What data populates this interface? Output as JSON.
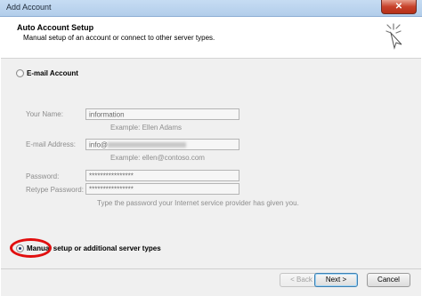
{
  "window": {
    "title": "Add Account",
    "close_glyph": "✕"
  },
  "header": {
    "title": "Auto Account Setup",
    "subtitle": "Manual setup of an account or connect to other server types.",
    "icon": "wizard-sparkle-icon"
  },
  "options": {
    "email_account": {
      "label": "E-mail Account",
      "selected": false
    },
    "manual_setup": {
      "label": "Manual setup or additional server types",
      "selected": true
    }
  },
  "form": {
    "your_name": {
      "label": "Your Name:",
      "value": "information",
      "example": "Example: Ellen Adams"
    },
    "email_address": {
      "label": "E-mail Address:",
      "value_prefix": "info@",
      "example": "Example: ellen@contoso.com"
    },
    "password": {
      "label": "Password:",
      "value": "****************"
    },
    "retype_password": {
      "label": "Retype Password:",
      "value": "****************"
    },
    "password_hint": "Type the password your Internet service provider has given you."
  },
  "buttons": {
    "back": "< Back",
    "next": "Next >",
    "cancel": "Cancel"
  },
  "colors": {
    "highlight": "#e10f0f",
    "title_bar": "#b2cdea",
    "close_button": "#c7422b"
  }
}
